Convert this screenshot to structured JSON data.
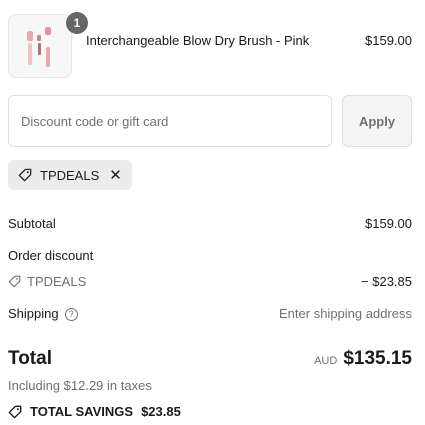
{
  "product": {
    "name": "Interchangeable Blow Dry Brush - Pink",
    "price": "$159.00",
    "quantity": "1"
  },
  "discount": {
    "placeholder": "Discount code or gift card",
    "apply_label": "Apply"
  },
  "applied_code": {
    "code": "TPDEALS",
    "remove": "✕"
  },
  "summary": {
    "subtotal_label": "Subtotal",
    "subtotal_value": "$159.00",
    "order_discount_label": "Order discount",
    "discount_code": "TPDEALS",
    "discount_value": "− $23.85",
    "shipping_label": "Shipping",
    "shipping_help": "?",
    "shipping_value": "Enter shipping address",
    "total_label": "Total",
    "currency": "AUD",
    "total_value": "$135.15",
    "taxes_note": "Including $12.29 in taxes",
    "savings_label": "TOTAL SAVINGS",
    "savings_value": "$23.85"
  },
  "colors": {
    "text": "#1a1a1a",
    "muted": "#707070",
    "badge": "#666666",
    "product_pink": "#e8a7b1"
  }
}
